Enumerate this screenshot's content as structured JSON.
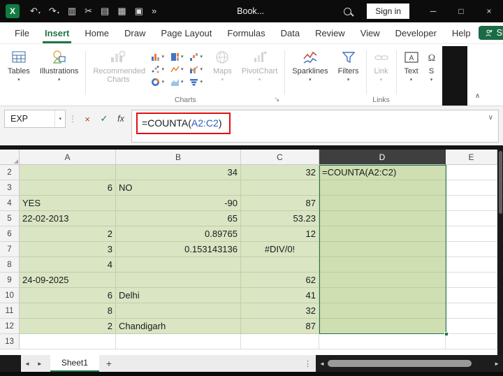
{
  "colors": {
    "accent_green": "#217346",
    "cell_fill": "#d9e5c3",
    "selected_fill": "#cfdfb2",
    "reference_blue": "#2b5dbd",
    "annotation_red": "#e01010",
    "header_selected": "#3f3f3f",
    "share_green": "#1b6b44",
    "titlebar_bg": "#0c0c0c"
  },
  "icons": {
    "excel_logo": "X",
    "dropdown": "▾",
    "minimize": "─",
    "maximize": "□",
    "close": "×",
    "cancel": "×",
    "enter": "✓",
    "fx": "fx",
    "expand_formula": "∨",
    "collapse_ribbon": "∧",
    "ellipsis": "⋮",
    "nav_left": "◄",
    "nav_right": "►",
    "add_sheet": "+",
    "dialog_launcher": "↘",
    "select_all": "◢"
  },
  "titlebar": {
    "title": "Book...",
    "sign_in_label": "Sign in",
    "quick_icons": [
      {
        "name": "undo-icon",
        "glyph": "↶",
        "caret": true
      },
      {
        "name": "redo-icon",
        "glyph": "↷",
        "caret": true
      },
      {
        "name": "copy-icon",
        "glyph": "▥"
      },
      {
        "name": "cut-icon",
        "glyph": "✂"
      },
      {
        "name": "paste-icon",
        "glyph": "▤"
      },
      {
        "name": "workbook-icon",
        "glyph": "▦"
      },
      {
        "name": "window-icon",
        "glyph": "▣"
      },
      {
        "name": "more-commands-icon",
        "glyph": "»"
      }
    ]
  },
  "menubar": {
    "tabs": [
      {
        "label": "File"
      },
      {
        "label": "Insert",
        "active": true
      },
      {
        "label": "Home"
      },
      {
        "label": "Draw"
      },
      {
        "label": "Page Layout"
      },
      {
        "label": "Formulas"
      },
      {
        "label": "Data"
      },
      {
        "label": "Review"
      },
      {
        "label": "View"
      },
      {
        "label": "Developer"
      },
      {
        "label": "Help"
      }
    ],
    "share_label": "Share"
  },
  "ribbon": {
    "tables_label": "Tables",
    "illustrations_label": "Illustrations",
    "recommended_charts_label": "Recommended Charts",
    "maps_label": "Maps",
    "pivotchart_label": "PivotChart",
    "sparklines_label": "Sparklines",
    "filters_label": "Filters",
    "link_label": "Link",
    "text_label": "Text",
    "symbols_partial_label": "S",
    "group_labels": {
      "charts": "Charts",
      "links": "Links"
    }
  },
  "formula_bar": {
    "name_box_value": "EXP",
    "formula_prefix": "=COUNTA(",
    "formula_reference": "A2:C2",
    "formula_suffix": ")"
  },
  "grid": {
    "columns": [
      {
        "label": "A"
      },
      {
        "label": "B"
      },
      {
        "label": "C"
      },
      {
        "label": "D",
        "selected": true
      },
      {
        "label": "E"
      }
    ],
    "rows": [
      {
        "n": 2,
        "cells": [
          {
            "v": "",
            "f": "g"
          },
          {
            "v": "34",
            "a": "r",
            "f": "g"
          },
          {
            "v": "32",
            "a": "r",
            "f": "g"
          },
          {
            "v": "=COUNTA(A2:C2)",
            "f": "s"
          },
          {
            "v": ""
          }
        ]
      },
      {
        "n": 3,
        "cells": [
          {
            "v": "6",
            "a": "r",
            "f": "g"
          },
          {
            "v": "NO",
            "f": "g"
          },
          {
            "v": "",
            "f": "g"
          },
          {
            "v": "",
            "f": "s"
          },
          {
            "v": ""
          }
        ]
      },
      {
        "n": 4,
        "cells": [
          {
            "v": "YES",
            "f": "g"
          },
          {
            "v": "-90",
            "a": "r",
            "f": "g"
          },
          {
            "v": "87",
            "a": "r",
            "f": "g"
          },
          {
            "v": "",
            "f": "s"
          },
          {
            "v": ""
          }
        ]
      },
      {
        "n": 5,
        "cells": [
          {
            "v": "22-02-2013",
            "f": "g"
          },
          {
            "v": "65",
            "a": "r",
            "f": "g"
          },
          {
            "v": "53.23",
            "a": "r",
            "f": "g"
          },
          {
            "v": "",
            "f": "s"
          },
          {
            "v": ""
          }
        ]
      },
      {
        "n": 6,
        "cells": [
          {
            "v": "2",
            "a": "r",
            "f": "g"
          },
          {
            "v": "0.89765",
            "a": "r",
            "f": "g"
          },
          {
            "v": "12",
            "a": "r",
            "f": "g"
          },
          {
            "v": "",
            "f": "s"
          },
          {
            "v": ""
          }
        ]
      },
      {
        "n": 7,
        "cells": [
          {
            "v": "3",
            "a": "r",
            "f": "g"
          },
          {
            "v": "0.153143136",
            "a": "r",
            "f": "g"
          },
          {
            "v": "#DIV/0!",
            "a": "c",
            "f": "g"
          },
          {
            "v": "",
            "f": "s"
          },
          {
            "v": ""
          }
        ]
      },
      {
        "n": 8,
        "cells": [
          {
            "v": "4",
            "a": "r",
            "f": "g"
          },
          {
            "v": "",
            "f": "g"
          },
          {
            "v": "",
            "f": "g"
          },
          {
            "v": "",
            "f": "s"
          },
          {
            "v": ""
          }
        ]
      },
      {
        "n": 9,
        "cells": [
          {
            "v": "24-09-2025",
            "f": "g"
          },
          {
            "v": "",
            "f": "g"
          },
          {
            "v": "62",
            "a": "r",
            "f": "g"
          },
          {
            "v": "",
            "f": "s"
          },
          {
            "v": ""
          }
        ]
      },
      {
        "n": 10,
        "cells": [
          {
            "v": "6",
            "a": "r",
            "f": "g"
          },
          {
            "v": "Delhi",
            "f": "g"
          },
          {
            "v": "41",
            "a": "r",
            "f": "g"
          },
          {
            "v": "",
            "f": "s"
          },
          {
            "v": ""
          }
        ]
      },
      {
        "n": 11,
        "cells": [
          {
            "v": "8",
            "a": "r",
            "f": "g"
          },
          {
            "v": "",
            "f": "g"
          },
          {
            "v": "32",
            "a": "r",
            "f": "g"
          },
          {
            "v": "",
            "f": "s"
          },
          {
            "v": ""
          }
        ]
      },
      {
        "n": 12,
        "cells": [
          {
            "v": "2",
            "a": "r",
            "f": "g"
          },
          {
            "v": "Chandigarh",
            "f": "g"
          },
          {
            "v": "87",
            "a": "r",
            "f": "g"
          },
          {
            "v": "",
            "f": "s"
          },
          {
            "v": ""
          }
        ]
      },
      {
        "n": 13,
        "cells": [
          {
            "v": ""
          },
          {
            "v": ""
          },
          {
            "v": ""
          },
          {
            "v": ""
          },
          {
            "v": ""
          }
        ]
      }
    ]
  },
  "sheet_bar": {
    "active_tab": "Sheet1"
  }
}
